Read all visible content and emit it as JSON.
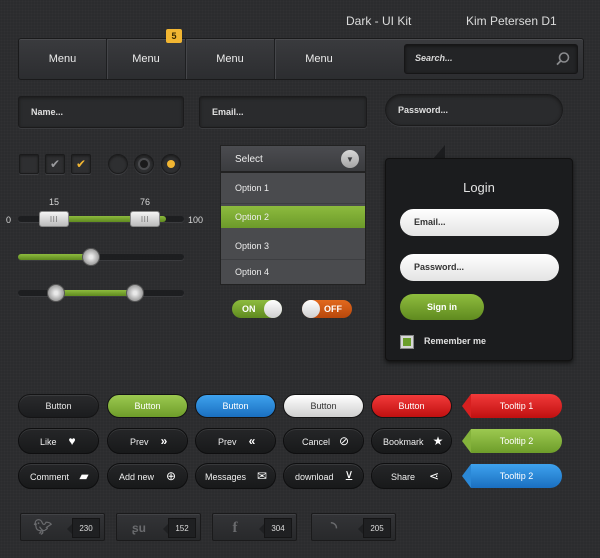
{
  "header": {
    "title": "Dark - UI Kit",
    "author": "Kim Petersen D1"
  },
  "nav": {
    "items": [
      "Menu",
      "Menu",
      "Menu",
      "Menu"
    ],
    "badge": "5",
    "search_placeholder": "Search..."
  },
  "fields": {
    "name": "Name...",
    "email": "Email...",
    "password": "Password..."
  },
  "sliders": {
    "range_min": "0",
    "range_max": "100",
    "low": "15",
    "high": "76",
    "handle_grip": "III",
    "single_value": 0.4,
    "dual_values": [
      0.25,
      0.75
    ]
  },
  "select": {
    "label": "Select",
    "options": [
      "Option 1",
      "Option 2",
      "Option 3",
      "Option 4"
    ],
    "selected": "Option 2"
  },
  "toggles": {
    "on": "ON",
    "off": "OFF"
  },
  "login": {
    "title": "Login",
    "email": "Email...",
    "password": "Password...",
    "signin": "Sign in",
    "remember": "Remember me"
  },
  "buttons": [
    "Button",
    "Button",
    "Button",
    "Button",
    "Button"
  ],
  "icon_buttons": {
    "row1": [
      {
        "label": "Like",
        "icon": "heart-icon"
      },
      {
        "label": "Prev",
        "icon": "double-chevron-right-icon"
      },
      {
        "label": "Prev",
        "icon": "double-chevron-left-icon"
      },
      {
        "label": "Cancel",
        "icon": "cancel-icon"
      },
      {
        "label": "Bookmark",
        "icon": "star-icon"
      }
    ],
    "row2": [
      {
        "label": "Comment",
        "icon": "comment-icon"
      },
      {
        "label": "Add new",
        "icon": "plus-icon"
      },
      {
        "label": "Messages",
        "icon": "envelope-icon"
      },
      {
        "label": "download",
        "icon": "download-icon"
      },
      {
        "label": "Share",
        "icon": "share-icon"
      }
    ]
  },
  "tooltips": [
    "Tooltip 1",
    "Tooltip 2",
    "Tooltip 2"
  ],
  "social": [
    {
      "icon": "twitter-icon",
      "count": "230"
    },
    {
      "icon": "stumbleupon-icon",
      "count": "152"
    },
    {
      "icon": "facebook-icon",
      "count": "304"
    },
    {
      "icon": "rss-icon",
      "count": "205"
    }
  ],
  "colors": {
    "accent_green": "#7ab33a",
    "accent_blue": "#2a8ae0",
    "accent_red": "#e02424",
    "badge_yellow": "#f2b632",
    "background": "#2b2c2e"
  }
}
